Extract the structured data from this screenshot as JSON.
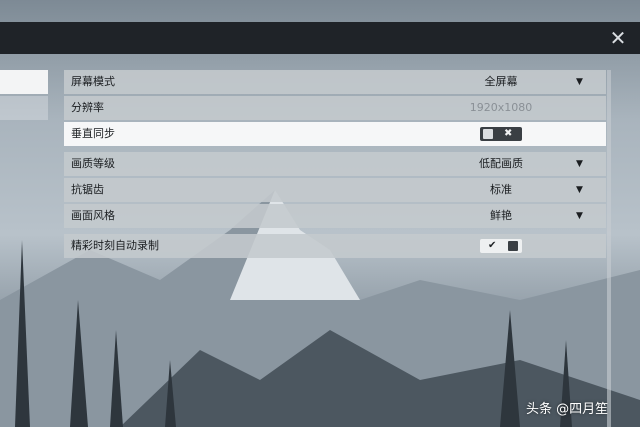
{
  "window": {
    "close_glyph": "✕"
  },
  "settings": {
    "groups": [
      {
        "rows": [
          {
            "label": "屏幕模式",
            "value": "全屏幕",
            "type": "dropdown"
          },
          {
            "label": "分辨率",
            "value": "1920x1080",
            "type": "static"
          },
          {
            "label": "垂直同步",
            "toggle_state": "off",
            "toggle_glyph": "✖",
            "type": "toggle"
          }
        ]
      },
      {
        "rows": [
          {
            "label": "画质等级",
            "value": "低配画质",
            "type": "dropdown"
          },
          {
            "label": "抗锯齿",
            "value": "标准",
            "type": "dropdown"
          },
          {
            "label": "画面风格",
            "value": "鲜艳",
            "type": "dropdown"
          }
        ]
      },
      {
        "rows": [
          {
            "label": "精彩时刻自动录制",
            "toggle_state": "on",
            "toggle_glyph": "✔",
            "type": "toggle"
          }
        ]
      }
    ],
    "dropdown_arrow": "▼"
  },
  "watermark": "头条 @四月笙",
  "colors": {
    "active_row": "#f6f7f8",
    "row": "#c4c9cd",
    "topbar": "#1f2328",
    "toggle_dark": "#3a3f44"
  }
}
